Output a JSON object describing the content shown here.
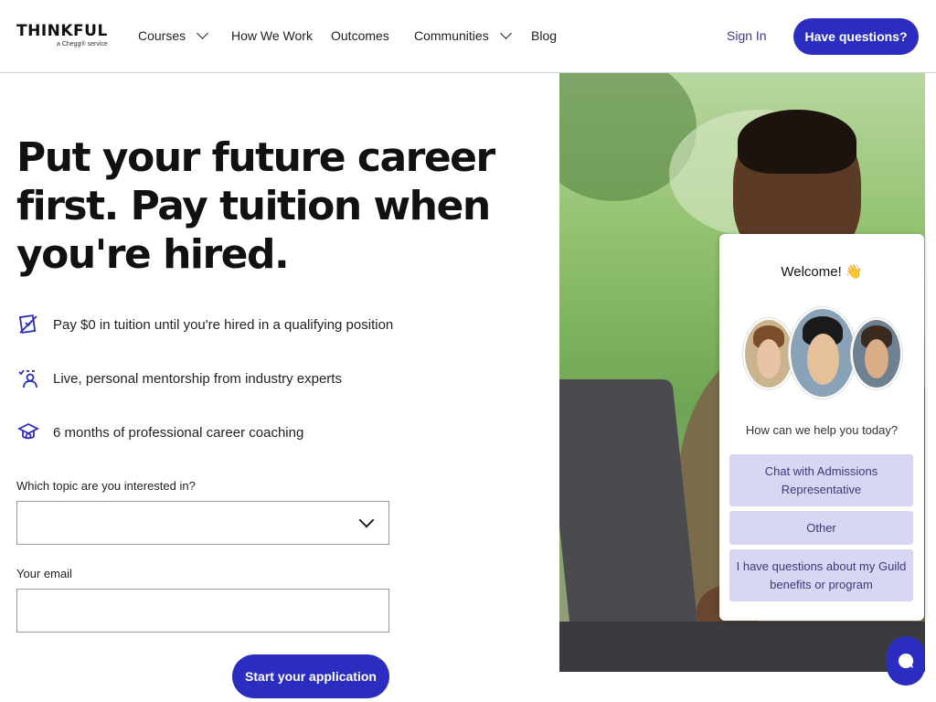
{
  "header": {
    "logo": "THINKFUL",
    "logo_sub": "a Chegg® service",
    "nav": [
      {
        "label": "Courses",
        "has_dropdown": true
      },
      {
        "label": "How We Work",
        "has_dropdown": false
      },
      {
        "label": "Outcomes",
        "has_dropdown": false
      },
      {
        "label": "Communities",
        "has_dropdown": true
      },
      {
        "label": "Blog",
        "has_dropdown": false
      }
    ],
    "sign_in": "Sign In",
    "cta": "Have questions?"
  },
  "hero": {
    "headline": "Put your future career first. Pay tuition when you're hired.",
    "features": [
      {
        "icon": "tuition-icon",
        "text": "Pay $0 in tuition until you're hired in a qualifying position"
      },
      {
        "icon": "mentor-icon",
        "text": "Live, personal mentorship from industry experts"
      },
      {
        "icon": "graduation-cap-icon",
        "text": "6 months of professional career coaching"
      }
    ]
  },
  "form": {
    "topic_label": "Which topic are you interested in?",
    "topic_value": "",
    "email_label": "Your email",
    "email_value": "",
    "submit": "Start your application"
  },
  "chat": {
    "welcome": "Welcome! 👋",
    "question": "How can we help you today?",
    "options": [
      "Chat with Admissions Representative",
      "Other",
      "I have questions about my Guild benefits or program"
    ]
  },
  "colors": {
    "brand": "#2b2dc0",
    "option_bg": "#d7d7f3"
  }
}
